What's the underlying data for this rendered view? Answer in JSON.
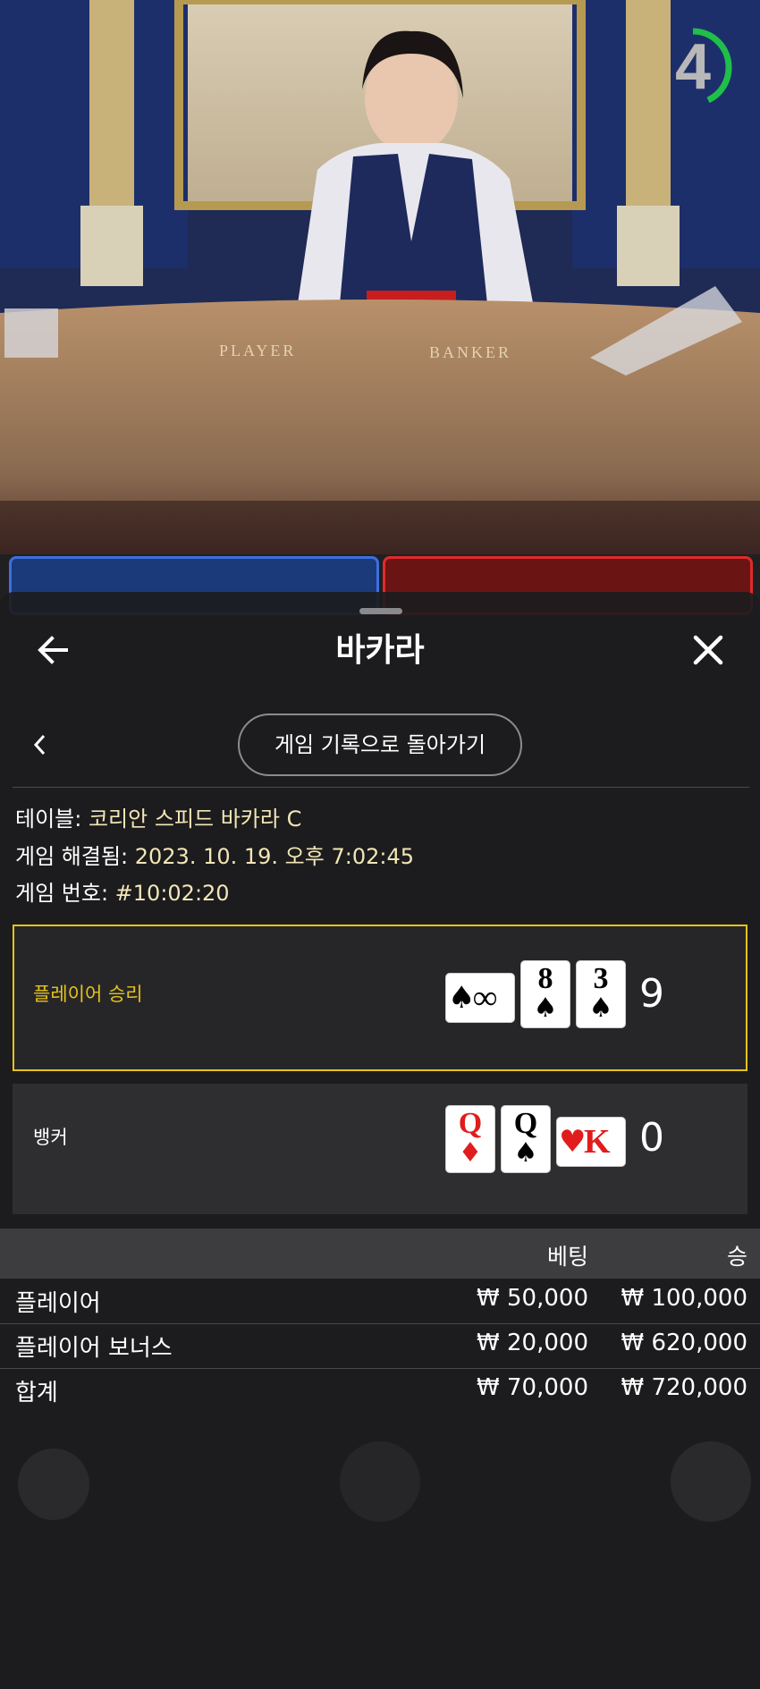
{
  "header": {
    "title": "바카라"
  },
  "history_button": {
    "label": "게임 기록으로 돌아가기"
  },
  "info": {
    "table_label": "테이블: ",
    "table_value": "코리안 스피드 바카라 C",
    "resolved_label": "게임 해결됨: ",
    "resolved_value": "2023. 10. 19. 오후 7:02:45",
    "number_label": "게임 번호: ",
    "number_value": "#10:02:20"
  },
  "timer": {
    "value": "4"
  },
  "video": {
    "player_label": "PLAYER",
    "banker_label": "BANKER"
  },
  "results": {
    "player": {
      "label": "플레이어 승리",
      "score": "9",
      "cards": [
        {
          "rank": "8",
          "suit": "♠"
        },
        {
          "rank": "3",
          "suit": "♠"
        }
      ],
      "sideways_card": {
        "rank": "∞",
        "suit": "♠"
      }
    },
    "banker": {
      "label": "뱅커",
      "score": "0",
      "cards": [
        {
          "rank": "Q",
          "suit": "♦"
        },
        {
          "rank": "Q",
          "suit": "♠"
        }
      ],
      "sideways_card": {
        "rank": "K",
        "suit": "♥"
      }
    }
  },
  "bet_table": {
    "headers": {
      "bet": "베팅",
      "win": "승"
    },
    "rows": [
      {
        "name": "플레이어",
        "bet": "₩ 50,000",
        "win": "₩ 100,000"
      },
      {
        "name": "플레이어 보너스",
        "bet": "₩ 20,000",
        "win": "₩ 620,000"
      },
      {
        "name": "합계",
        "bet": "₩ 70,000",
        "win": "₩ 720,000"
      }
    ]
  },
  "colors": {
    "highlight": "#e6c31a",
    "player_blue": "#3d6fe0",
    "banker_red": "#e02a2a",
    "timer_green": "#1fbf4a"
  }
}
